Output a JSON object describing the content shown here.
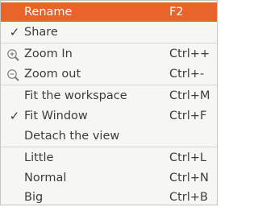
{
  "menu": {
    "items": [
      {
        "label": "Rename",
        "shortcut": "F2"
      },
      {
        "label": "Share",
        "shortcut": "",
        "check": "✓"
      },
      {
        "label": "Zoom In",
        "shortcut": "Ctrl++",
        "icon": "zoom-in-icon"
      },
      {
        "label": "Zoom out",
        "shortcut": "Ctrl+-",
        "icon": "zoom-out-icon"
      },
      {
        "label": "Fit the workspace",
        "shortcut": "Ctrl+M"
      },
      {
        "label": "Fit Window",
        "shortcut": "Ctrl+F",
        "check": "✓"
      },
      {
        "label": "Detach the view",
        "shortcut": ""
      },
      {
        "label": "Little",
        "shortcut": "Ctrl+L"
      },
      {
        "label": "Normal",
        "shortcut": "Ctrl+N"
      },
      {
        "label": "Big",
        "shortcut": "Ctrl+B"
      }
    ]
  },
  "colors": {
    "highlight": "#e9642b",
    "background": "#f6f6f5",
    "text": "#3c3c3c",
    "separator": "#d8d6d2"
  }
}
